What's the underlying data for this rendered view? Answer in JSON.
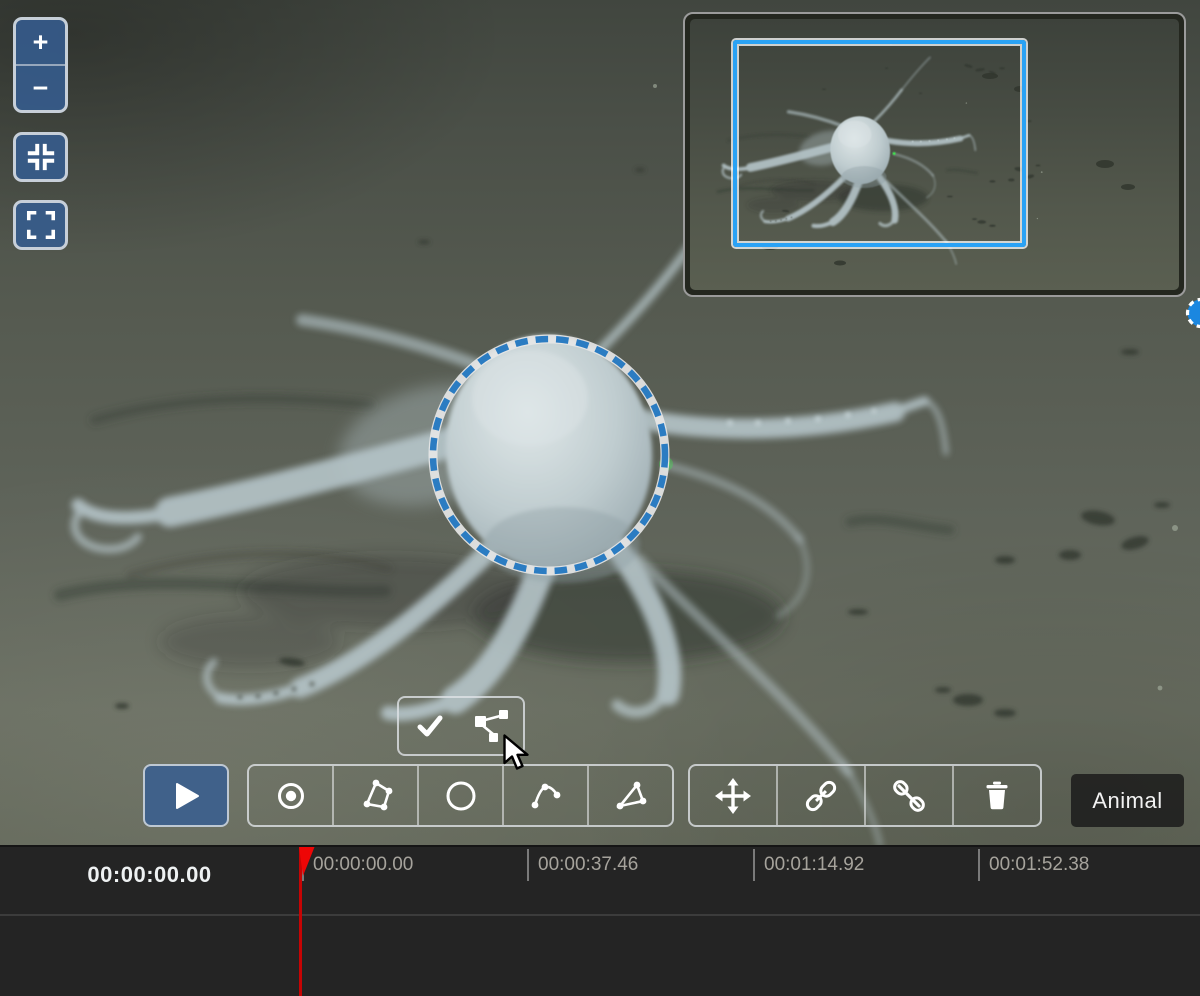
{
  "controls": {
    "zoom_in_label": "+",
    "zoom_out_label": "−",
    "buttons": [
      "zoom-in",
      "zoom-out",
      "fit-view",
      "fullscreen"
    ]
  },
  "minimap": {
    "visible": true,
    "viewport_border_color": "#2aa2f4"
  },
  "annotation": {
    "shape": "circle",
    "state": "editing",
    "stroke_color": "#2b7cc2",
    "band_color": "#e6e6e6"
  },
  "edit_toolbar": {
    "buttons": [
      {
        "name": "confirm",
        "icon": "check-icon",
        "selected": false
      },
      {
        "name": "edit-vertices",
        "icon": "vertices-icon",
        "selected": true
      }
    ]
  },
  "main_toolbar": {
    "play": {
      "icon": "play-icon"
    },
    "shape_tools": [
      {
        "name": "point",
        "icon": "point-icon",
        "selected": false
      },
      {
        "name": "polygon",
        "icon": "polygon-icon",
        "selected": false
      },
      {
        "name": "circle",
        "icon": "circle-icon",
        "selected": true
      },
      {
        "name": "line",
        "icon": "line-icon",
        "selected": false
      },
      {
        "name": "polyline",
        "icon": "polyline-icon",
        "selected": false
      }
    ],
    "edit_tools": [
      {
        "name": "move",
        "icon": "move-icon",
        "selected": true
      },
      {
        "name": "link",
        "icon": "link-icon",
        "selected": false
      },
      {
        "name": "unlink",
        "icon": "unlink-icon",
        "selected": false
      },
      {
        "name": "delete",
        "icon": "trash-icon",
        "selected": false
      }
    ],
    "type_label": "Animal"
  },
  "timeline": {
    "current_time": "00:00:00.00",
    "ticks": [
      "00:00:00.00",
      "00:00:37.46",
      "00:01:14.92",
      "00:01:52.38"
    ],
    "playhead_color": "#c60404"
  },
  "colors": {
    "tool_button": "#7d9dc0",
    "tool_selected": "#215088",
    "viewport_blue": "#2aa2f4",
    "annotation_blue": "#2b7cc2",
    "laser_green": "#3fe44e",
    "timeline_bg": "#242424",
    "type_chip_bg": "#1a1a1a"
  }
}
